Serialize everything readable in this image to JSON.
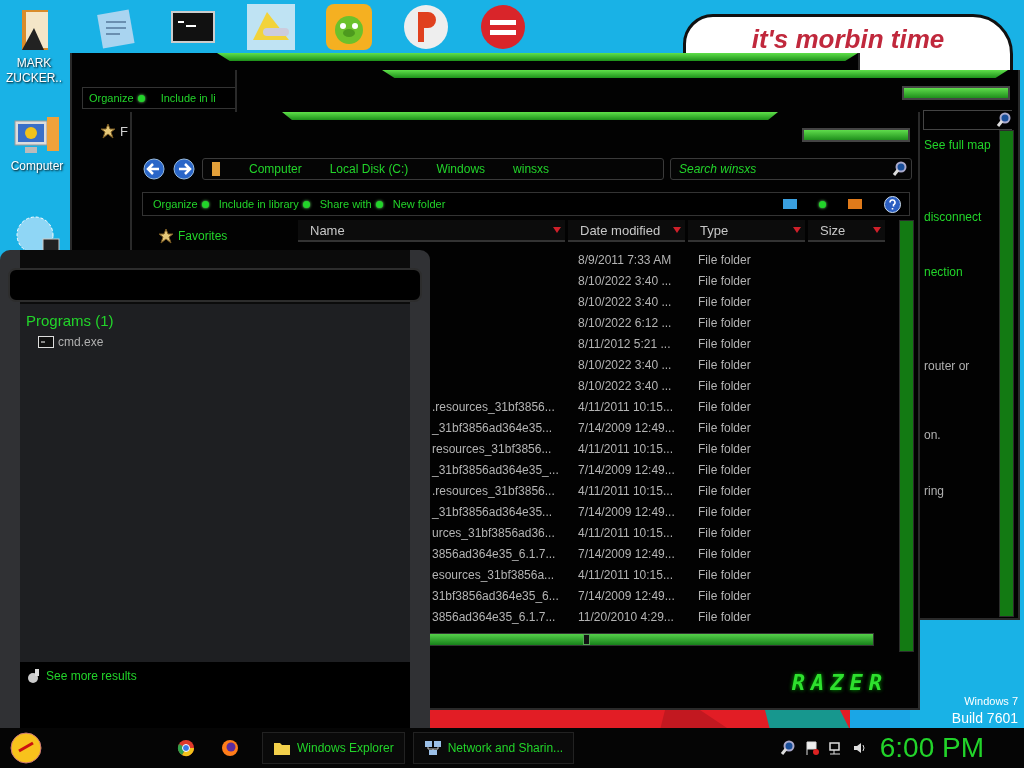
{
  "desktop": {
    "icons": [
      {
        "label": "MARK ZUCKER..",
        "kind": "book"
      },
      {
        "kind": "notes"
      },
      {
        "kind": "console"
      },
      {
        "kind": "folder"
      },
      {
        "kind": "game"
      },
      {
        "kind": "letter"
      },
      {
        "kind": "dev"
      },
      {
        "label": "Computer",
        "kind": "computer"
      },
      {
        "kind": "globe"
      }
    ],
    "wallpaper_caption": "it's morbin time",
    "build_info": [
      "Windows 7",
      "Build 7601"
    ]
  },
  "back_window_1": {
    "toolbar": [
      "Organize",
      "Include in li"
    ],
    "nav_item": "F"
  },
  "back_window_2": {
    "lines": [
      {
        "text": "See full map",
        "kind": "link"
      },
      {
        "text": "disconnect",
        "kind": "link"
      },
      {
        "text": "nection",
        "kind": "link"
      },
      {
        "text": "router or",
        "kind": "text"
      },
      {
        "text": "on.",
        "kind": "text"
      },
      {
        "text": "ring",
        "kind": "text"
      }
    ]
  },
  "explorer": {
    "breadcrumbs": [
      "Computer",
      "Local Disk (C:)",
      "Windows",
      "winsxs"
    ],
    "search": {
      "placeholder": "Search winsxs"
    },
    "toolbar": [
      "Organize",
      "Include in library",
      "Share with",
      "New folder"
    ],
    "sidebar": [
      {
        "label": "Favorites"
      }
    ],
    "columns": [
      "Name",
      "Date modified",
      "Type",
      "Size"
    ],
    "rows": [
      {
        "date": "8/9/2011 7:33 AM",
        "type": "File folder"
      },
      {
        "date": "8/10/2022 3:40 ...",
        "type": "File folder"
      },
      {
        "date": "8/10/2022 3:40 ...",
        "type": "File folder"
      },
      {
        "date": "8/10/2022 6:12 ...",
        "type": "File folder"
      },
      {
        "date": "8/11/2012 5:21 ...",
        "type": "File folder"
      },
      {
        "date": "8/10/2022 3:40 ...",
        "type": "File folder"
      },
      {
        "date": "8/10/2022 3:40 ...",
        "type": "File folder"
      },
      {
        "name": ".resources_31bf3856...",
        "date": "4/11/2011 10:15...",
        "type": "File folder"
      },
      {
        "name": "_31bf3856ad364e35...",
        "date": "7/14/2009 12:49...",
        "type": "File folder"
      },
      {
        "name": "resources_31bf3856...",
        "date": "4/11/2011 10:15...",
        "type": "File folder"
      },
      {
        "name": "_31bf3856ad364e35_...",
        "date": "7/14/2009 12:49...",
        "type": "File folder"
      },
      {
        "name": ".resources_31bf3856...",
        "date": "4/11/2011 10:15...",
        "type": "File folder"
      },
      {
        "name": "_31bf3856ad364e35...",
        "date": "7/14/2009 12:49...",
        "type": "File folder"
      },
      {
        "name": "urces_31bf3856ad36...",
        "date": "4/11/2011 10:15...",
        "type": "File folder"
      },
      {
        "name": "3856ad364e35_6.1.7...",
        "date": "7/14/2009 12:49...",
        "type": "File folder"
      },
      {
        "name": "esources_31bf3856a...",
        "date": "4/11/2011 10:15...",
        "type": "File folder"
      },
      {
        "name": "31bf3856ad364e35_6...",
        "date": "7/14/2009 12:49...",
        "type": "File folder"
      },
      {
        "name": "3856ad364e35_6.1.7...",
        "date": "11/20/2010 4:29...",
        "type": "File folder"
      }
    ],
    "logo": "RAZER"
  },
  "start_menu": {
    "group": "Programs (1)",
    "results": [
      "cmd.exe"
    ],
    "see_more": "See more results"
  },
  "taskbar": {
    "pinned": [
      {
        "kind": "chrome"
      },
      {
        "kind": "firefox"
      }
    ],
    "tasks": [
      {
        "label": "Windows Explorer",
        "kind": "folder"
      },
      {
        "label": "Network and Sharin...",
        "kind": "network"
      }
    ],
    "clock": "6:00 PM"
  }
}
